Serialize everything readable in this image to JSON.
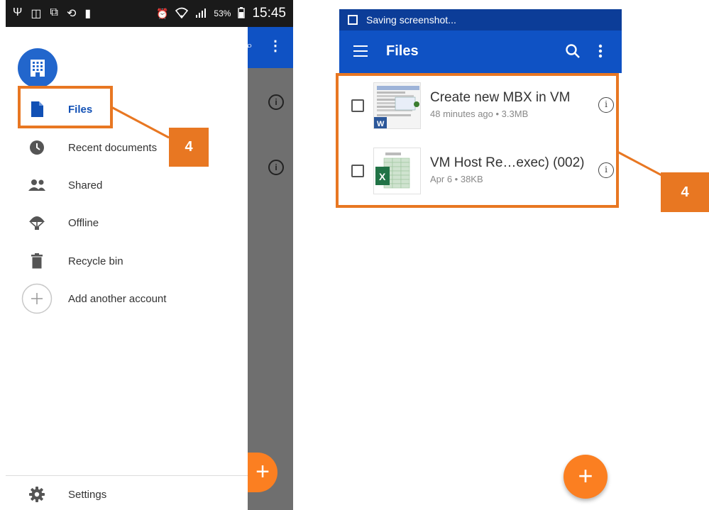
{
  "left_phone": {
    "status_bar": {
      "battery": "53%",
      "time": "15:45"
    },
    "drawer": {
      "items": [
        {
          "label": "Files",
          "icon": "file-icon",
          "active": true
        },
        {
          "label": "Recent documents",
          "icon": "clock-icon",
          "active": false
        },
        {
          "label": "Shared",
          "icon": "people-icon",
          "active": false
        },
        {
          "label": "Offline",
          "icon": "offline-parachute-icon",
          "active": false
        },
        {
          "label": "Recycle bin",
          "icon": "trash-icon",
          "active": false
        },
        {
          "label": "Add another account",
          "icon": "plus-circle-icon",
          "active": false
        }
      ],
      "settings_label": "Settings"
    }
  },
  "right_phone": {
    "status_bar": {
      "notification": "Saving screenshot..."
    },
    "app_bar": {
      "title": "Files"
    },
    "files": [
      {
        "name": "Create new MBX in VM",
        "meta": "48 minutes ago • 3.3MB",
        "type": "word"
      },
      {
        "name": "VM Host Re…exec) (002)",
        "meta": "Apr 6 • 38KB",
        "type": "excel"
      }
    ]
  },
  "callouts": {
    "left_badge": "4",
    "right_badge": "4",
    "color": "#e87722"
  },
  "colors": {
    "app_bar": "#0f52c4",
    "status_bar_right": "#0c3d98",
    "accent_fab": "#fb7f21",
    "active_item": "#1150b5"
  }
}
